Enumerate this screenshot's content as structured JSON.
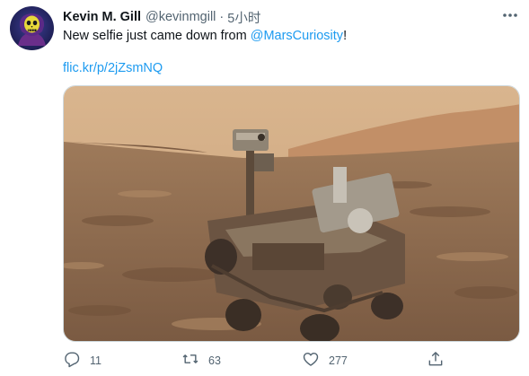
{
  "author": {
    "display_name": "Kevin M. Gill",
    "handle": "@kevinmgill",
    "separator": "·",
    "time": "5小时"
  },
  "tweet": {
    "text_prefix": "New selfie just came down from ",
    "mention": "@MarsCuriosity",
    "text_suffix": "!",
    "link": "flic.kr/p/2jZsmNQ"
  },
  "stats": {
    "replies": "11",
    "retweets": "63",
    "likes": "277"
  },
  "icons": {
    "more": "more-icon",
    "reply": "reply-icon",
    "retweet": "retweet-icon",
    "like": "heart-icon",
    "share": "share-icon"
  },
  "colors": {
    "link": "#1d9bf0",
    "secondary_text": "#536471"
  }
}
